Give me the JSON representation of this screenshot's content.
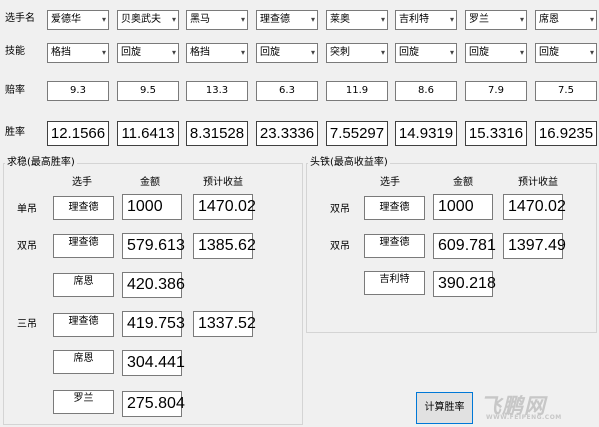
{
  "row_labels": {
    "player": "选手名",
    "skill": "技能",
    "win_rate": "赔率",
    "odds": "胜率"
  },
  "players": [
    {
      "name": "爱德华",
      "skill": "格挡",
      "rate": "9.3",
      "odds": "12.1566"
    },
    {
      "name": "贝奥武夫",
      "skill": "回旋",
      "rate": "9.5",
      "odds": "11.6413"
    },
    {
      "name": "黑马",
      "skill": "格挡",
      "rate": "13.3",
      "odds": "8.31528"
    },
    {
      "name": "理查德",
      "skill": "回旋",
      "rate": "6.3",
      "odds": "23.3336"
    },
    {
      "name": "莱奥",
      "skill": "突刺",
      "rate": "11.9",
      "odds": "7.55297"
    },
    {
      "name": "吉利特",
      "skill": "回旋",
      "rate": "8.6",
      "odds": "14.9319"
    },
    {
      "name": "罗兰",
      "skill": "回旋",
      "rate": "7.9",
      "odds": "15.3316"
    },
    {
      "name": "席恩",
      "skill": "回旋",
      "rate": "7.5",
      "odds": "16.9235"
    }
  ],
  "left_group": {
    "title": "求稳(最高胜率)",
    "headers": {
      "player": "选手",
      "amount": "金额",
      "expected": "预计收益"
    },
    "single": {
      "label": "单吊",
      "player": "理查德",
      "amount": "1000",
      "expected": "1470.02"
    },
    "double": {
      "label": "双吊",
      "rows": [
        {
          "player": "理查德",
          "amount": "579.613",
          "expected": "1385.62"
        },
        {
          "player": "席恩",
          "amount": "420.386"
        }
      ]
    },
    "triple": {
      "label": "三吊",
      "rows": [
        {
          "player": "理查德",
          "amount": "419.753",
          "expected": "1337.52"
        },
        {
          "player": "席恩",
          "amount": "304.441"
        },
        {
          "player": "罗兰",
          "amount": "275.804"
        }
      ]
    }
  },
  "right_group": {
    "title": "头铁(最高收益率)",
    "headers": {
      "player": "选手",
      "amount": "金额",
      "expected": "预计收益"
    },
    "single": {
      "label": "双吊",
      "player": "理查德",
      "amount": "1000",
      "expected": "1470.02"
    },
    "double": {
      "label": "双吊",
      "rows": [
        {
          "player": "理查德",
          "amount": "609.781",
          "expected": "1397.49"
        },
        {
          "player": "吉利特",
          "amount": "390.218"
        }
      ]
    }
  },
  "calc_button": "计算胜率",
  "watermark": {
    "logo": "飞鹏网",
    "url": "WWW.FEIPENG.COM"
  }
}
